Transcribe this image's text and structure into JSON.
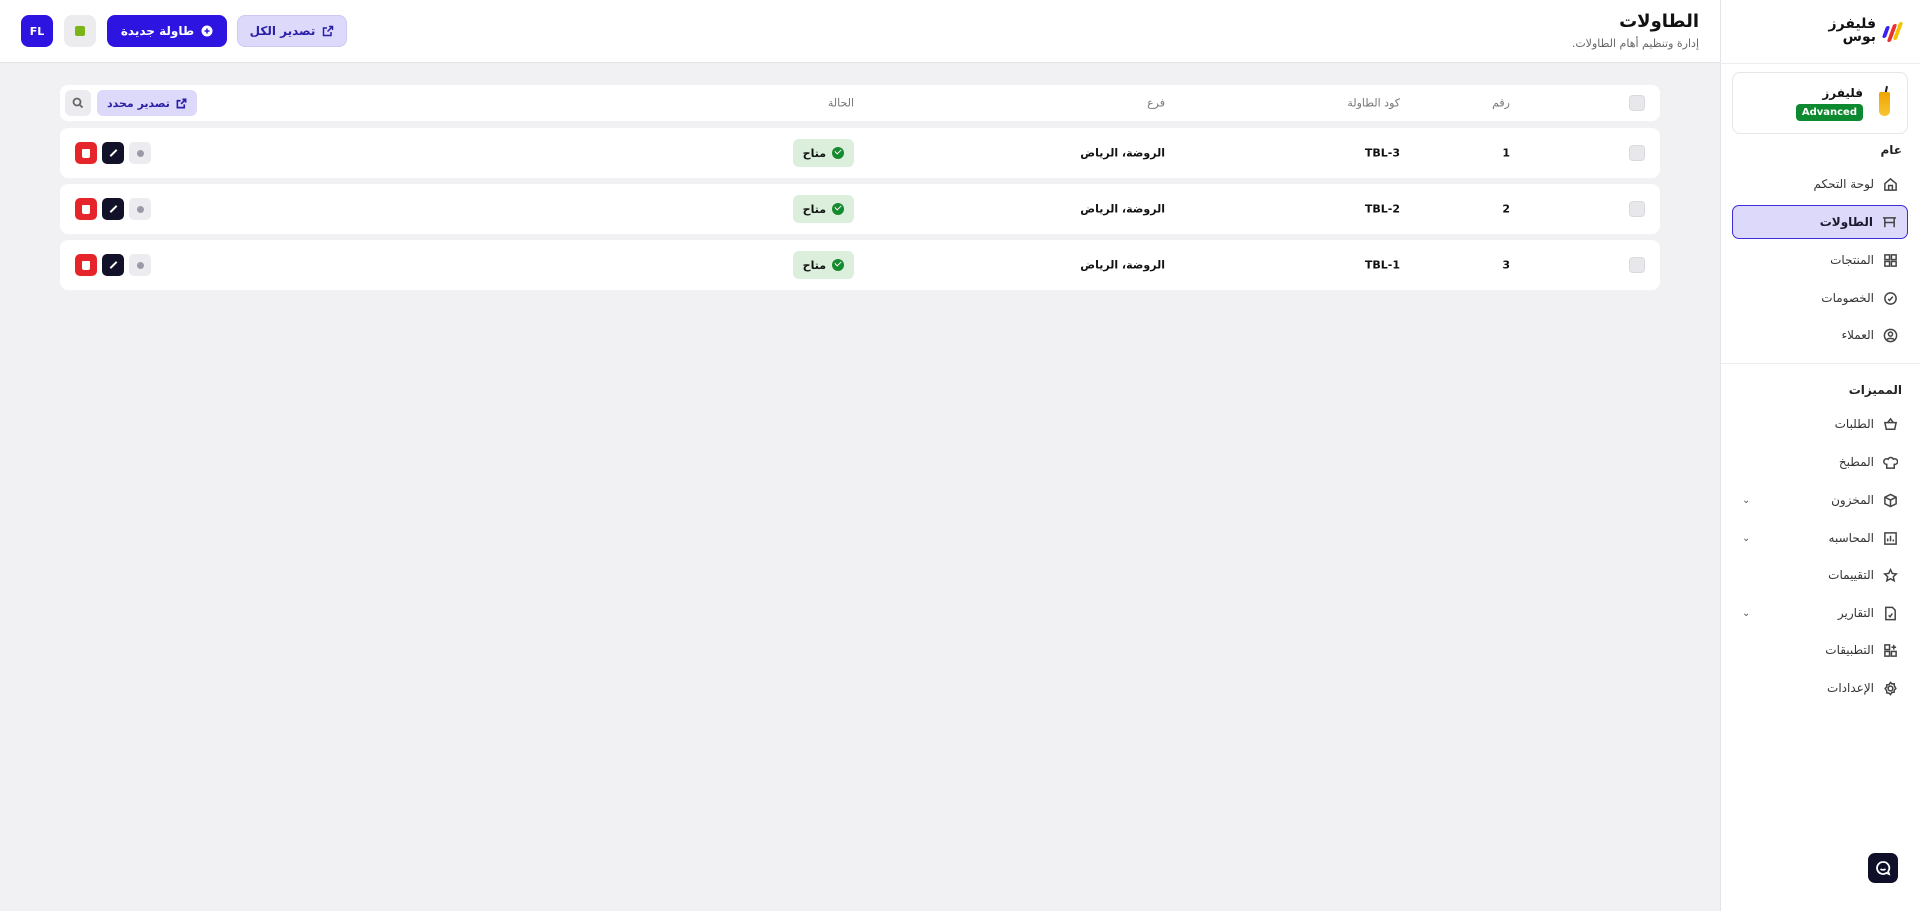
{
  "brand": {
    "name": "فليفرز بوس"
  },
  "profile": {
    "name": "فليفرز",
    "plan": "Advanced"
  },
  "sidebar": {
    "general_title": "عام",
    "general_items": [
      {
        "label": "لوحة التحكم",
        "icon": "home-icon"
      },
      {
        "label": "الطاولات",
        "icon": "table-icon",
        "active": true
      },
      {
        "label": "المنتجات",
        "icon": "grid-icon"
      },
      {
        "label": "الخصومات",
        "icon": "discount-icon"
      },
      {
        "label": "العملاء",
        "icon": "user-circle-icon"
      }
    ],
    "features_title": "المميزات",
    "feature_items": [
      {
        "label": "الطلبات",
        "icon": "basket-icon"
      },
      {
        "label": "المطبخ",
        "icon": "chef-hat-icon"
      },
      {
        "label": "المخزون",
        "icon": "box-icon",
        "expandable": true
      },
      {
        "label": "المحاسبه",
        "icon": "chart-icon",
        "expandable": true
      },
      {
        "label": "التقييمات",
        "icon": "star-icon"
      },
      {
        "label": "التقارير",
        "icon": "report-icon",
        "expandable": true
      },
      {
        "label": "التطبيقات",
        "icon": "apps-icon"
      },
      {
        "label": "الإعدادات",
        "icon": "settings-icon"
      }
    ]
  },
  "header": {
    "title": "الطاولات",
    "subtitle": "إدارة وتنظيم أهام الطاولات.",
    "export_all": "تصدير الكل",
    "new_table": "طاولة جديدة",
    "avatar": "FL"
  },
  "table": {
    "columns": {
      "number": "رقم",
      "code": "كود الطاولة",
      "branch": "فرع",
      "status": "الحالة"
    },
    "export_selected": "تصدير محدد",
    "rows": [
      {
        "number": "1",
        "code": "TBL-3",
        "branch": "الروضة، الرياض",
        "status": "متاح"
      },
      {
        "number": "2",
        "code": "TBL-2",
        "branch": "الروضة، الرياض",
        "status": "متاح"
      },
      {
        "number": "3",
        "code": "TBL-1",
        "branch": "الروضة، الرياض",
        "status": "متاح"
      }
    ]
  },
  "colors": {
    "accent": "#2d14e0",
    "active_bg": "#ddd9fb",
    "success": "#168a2e",
    "danger": "#e5252a"
  }
}
